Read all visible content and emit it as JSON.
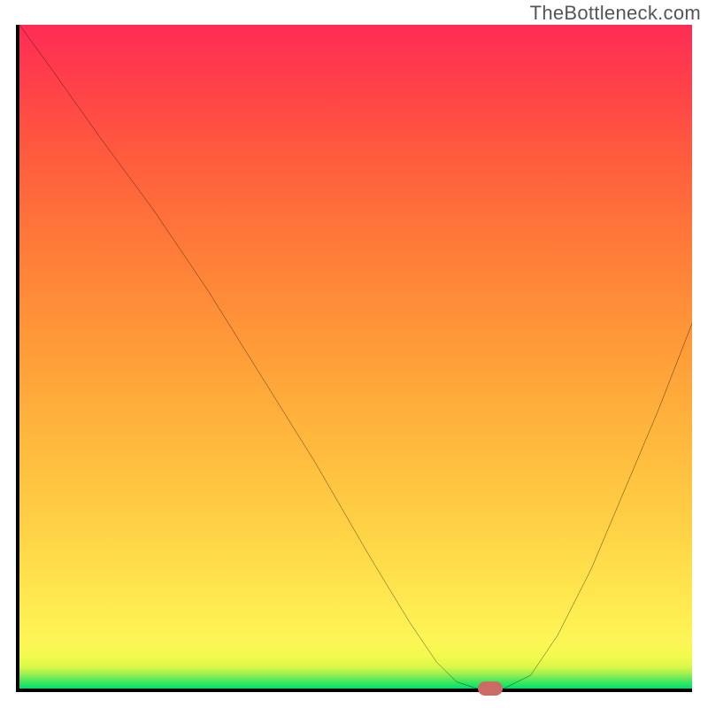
{
  "watermark": "TheBottleneck.com",
  "colors": {
    "axis": "#000000",
    "curve": "#000000",
    "marker": "#cc6b66",
    "gradient_top": "#ff2c56",
    "gradient_bottom": "#00e06a"
  },
  "chart_data": {
    "type": "line",
    "title": "",
    "xlabel": "",
    "ylabel": "",
    "xlim": [
      0,
      100
    ],
    "ylim": [
      0,
      100
    ],
    "grid": false,
    "legend": false,
    "series": [
      {
        "name": "bottleneck-curve",
        "x": [
          0,
          5,
          12,
          20,
          28,
          36,
          44,
          52,
          58,
          62,
          65,
          68,
          72,
          76,
          80,
          85,
          90,
          95,
          100
        ],
        "y": [
          100,
          93,
          83,
          72,
          60,
          47,
          34,
          20,
          10,
          4,
          1,
          0,
          0,
          2,
          8,
          18,
          30,
          42,
          55
        ]
      }
    ],
    "marker": {
      "x": 70,
      "y": 0
    },
    "annotations": []
  }
}
